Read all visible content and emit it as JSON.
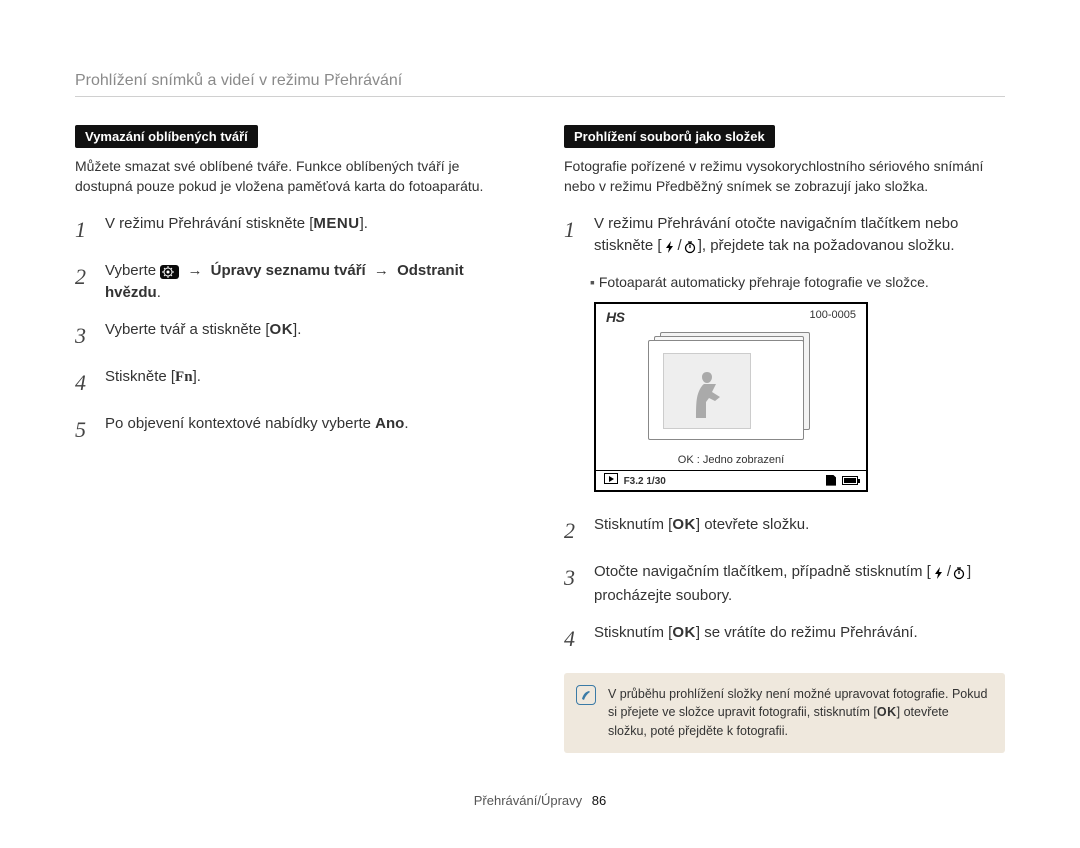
{
  "page_title": "Prohlížení snímků a videí v režimu Přehrávání",
  "left": {
    "badge": "Vymazání oblíbených tváří",
    "intro": "Můžete smazat své oblíbené tváře. Funkce oblíbených tváří je dostupná pouze pokud je vložena paměťová karta do fotoaparátu.",
    "step1_a": "V režimu Přehrávání stiskněte [",
    "step1_menu": "MENU",
    "step1_b": "].",
    "step2_a": "Vyberte ",
    "step2_b": " → ",
    "step2_bold1": "Úpravy seznamu tváří",
    "step2_c": " → ",
    "step2_bold2": "Odstranit hvězdu",
    "step2_d": ".",
    "step3_a": "Vyberte tvář a stiskněte [",
    "step3_ok": "OK",
    "step3_b": "].",
    "step4_a": "Stiskněte [",
    "step4_fn": "Fn",
    "step4_b": "].",
    "step5_a": "Po objevení kontextové nabídky vyberte ",
    "step5_bold": "Ano",
    "step5_b": "."
  },
  "right": {
    "badge": "Prohlížení souborů jako složek",
    "intro": "Fotografie pořízené v režimu vysokorychlostního sériového snímání nebo v režimu Předběžný snímek se zobrazují jako složka.",
    "step1_a": "V režimu Přehrávání otočte navigačním tlačítkem nebo stiskněte [",
    "step1_b": "], přejdete tak na požadovanou složku.",
    "bullet": "Fotoaparát automaticky přehraje fotografie ve složce.",
    "lcd": {
      "hs": "HS",
      "fileno": "100-0005",
      "caption": "OK : Jedno zobrazení",
      "exposure": "F3.2  1/30"
    },
    "step2_a": "Stisknutím [",
    "step2_ok": "OK",
    "step2_b": "] otevřete složku.",
    "step3_a": "Otočte navigačním tlačítkem, případně stisknutím [",
    "step3_b": "] procházejte soubory.",
    "step4_a": "Stisknutím [",
    "step4_ok": "OK",
    "step4_b": "] se vrátíte do režimu Přehrávání.",
    "note_a": "V průběhu prohlížení složky není možné upravovat fotografie. Pokud si přejete ve složce upravit fotografii, stisknutím [",
    "note_ok": "OK",
    "note_b": "] otevřete složku, poté přejděte k fotografii."
  },
  "footer": {
    "section": "Přehrávání/Úpravy",
    "page": "86"
  }
}
